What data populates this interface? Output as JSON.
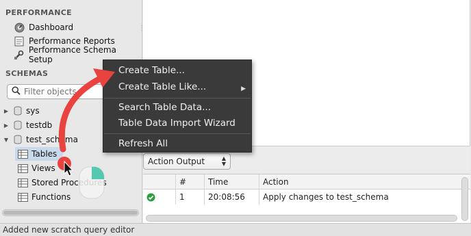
{
  "sidebar": {
    "performance_title": "PERFORMANCE",
    "performance_items": [
      {
        "label": "Dashboard",
        "icon": "dashboard-icon"
      },
      {
        "label": "Performance Reports",
        "icon": "reports-icon"
      },
      {
        "label": "Performance Schema Setup",
        "icon": "wrench-icon"
      }
    ],
    "schemas_title": "SCHEMAS",
    "filter_placeholder": "Filter objects",
    "schemas": [
      {
        "label": "sys",
        "expanded": false
      },
      {
        "label": "testdb",
        "expanded": false
      },
      {
        "label": "test_schema",
        "expanded": true
      }
    ],
    "schema_children": [
      {
        "label": "Tables",
        "selected": true
      },
      {
        "label": "Views"
      },
      {
        "label": "Stored Procedures"
      },
      {
        "label": "Functions"
      }
    ]
  },
  "context_menu": {
    "items": [
      "Create Table...",
      "Create Table Like...",
      "Search Table Data...",
      "Table Data Import Wizard",
      "Refresh All"
    ]
  },
  "output": {
    "selector": "Action Output",
    "columns": [
      "",
      "#",
      "Time",
      "Action"
    ],
    "rows": [
      {
        "status": "success",
        "num": "1",
        "time": "20:08:56",
        "action": "Apply changes to test_schema"
      }
    ]
  },
  "statusbar": {
    "text": "Added new scratch query editor"
  },
  "colors": {
    "menu_bg": "#3a3a3a",
    "annotation_red": "#e8433f",
    "selection": "#c9d9ec",
    "success": "#2e9e3e"
  }
}
